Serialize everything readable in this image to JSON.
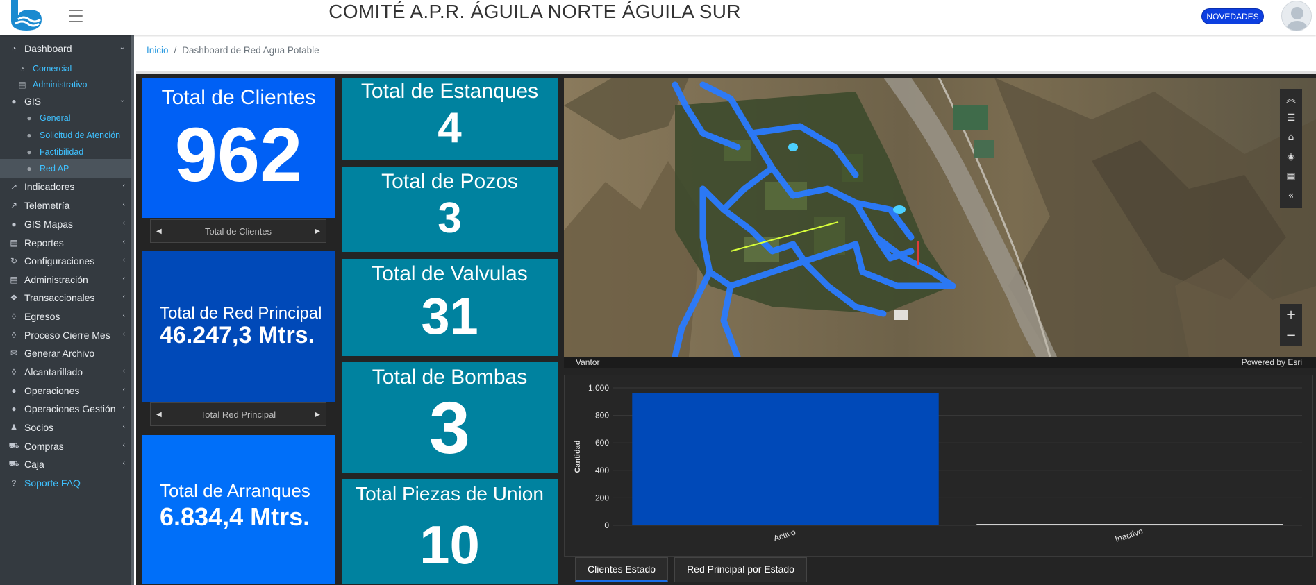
{
  "app": {
    "title": "COMITÉ A.P.R. ÁGUILA NORTE ÁGUILA SUR",
    "news_label": "NOVEDADES"
  },
  "sidebar": {
    "items": [
      {
        "label": "Dashboard",
        "icon": "dashboard-icon",
        "open": true
      },
      {
        "label": "Comercial",
        "icon": "gauge-icon",
        "sub": true
      },
      {
        "label": "Administrativo",
        "icon": "building-icon",
        "sub": true
      },
      {
        "label": "GIS",
        "icon": "globe-icon",
        "open": true
      },
      {
        "label": "General",
        "icon": "globe-icon",
        "sub": true
      },
      {
        "label": "Solicitud de Atención",
        "icon": "globe-icon",
        "sub": true
      },
      {
        "label": "Factibilidad",
        "icon": "globe-icon",
        "sub": true
      },
      {
        "label": "Red AP",
        "icon": "globe-icon",
        "sub": true,
        "active": true
      },
      {
        "label": "Indicadores",
        "icon": "chart-line-icon"
      },
      {
        "label": "Telemetría",
        "icon": "chart-line-icon"
      },
      {
        "label": "GIS Mapas",
        "icon": "globe-icon"
      },
      {
        "label": "Reportes",
        "icon": "list-icon"
      },
      {
        "label": "Configuraciones",
        "icon": "sync-icon"
      },
      {
        "label": "Administración",
        "icon": "building-icon"
      },
      {
        "label": "Transaccionales",
        "icon": "cubes-icon"
      },
      {
        "label": "Egresos",
        "icon": "drop-icon"
      },
      {
        "label": "Proceso Cierre Mes",
        "icon": "drop-icon"
      },
      {
        "label": "Generar Archivo",
        "icon": "envelope-icon"
      },
      {
        "label": "Alcantarillado",
        "icon": "drop-icon"
      },
      {
        "label": "Operaciones",
        "icon": "globe-icon"
      },
      {
        "label": "Operaciones Gestión",
        "icon": "globe-icon"
      },
      {
        "label": "Socios",
        "icon": "users-icon"
      },
      {
        "label": "Compras",
        "icon": "cart-icon"
      },
      {
        "label": "Caja",
        "icon": "cart-icon"
      },
      {
        "label": "Soporte FAQ",
        "icon": "question-icon",
        "link": true
      }
    ]
  },
  "breadcrumb": {
    "home": "Inicio",
    "separator": "/",
    "current": "Dashboard de Red Agua Potable"
  },
  "cards": {
    "clientes": {
      "title": "Total de Clientes",
      "value": "962",
      "pager": "Total de Clientes",
      "color": "#0060f5"
    },
    "red_principal": {
      "title": "Total de Red Principal",
      "value": "46.247,3 Mtrs.",
      "pager": "Total Red Principal",
      "color": "#0049b8"
    },
    "arranques": {
      "title": "Total de Arranques",
      "value": "6.834,4 Mtrs.",
      "color": "#006ff9"
    },
    "estanques": {
      "title": "Total de Estanques",
      "value": "4",
      "color": "#00829f"
    },
    "pozos": {
      "title": "Total de Pozos",
      "value": "3",
      "color": "#00829f"
    },
    "valvulas": {
      "title": "Total de Valvulas",
      "value": "31",
      "color": "#00829f"
    },
    "bombas": {
      "title": "Total de Bombas",
      "value": "3",
      "color": "#00829f"
    },
    "piezas": {
      "title": "Total Piezas de Union",
      "value": "10",
      "color": "#00829f"
    }
  },
  "map": {
    "attribution_left": "Vantor",
    "attribution_right": "Powered by Esri",
    "tools": [
      "collapse-up-icon",
      "legend-list-icon",
      "home-icon",
      "layers-icon",
      "qr-icon",
      "collapse-left-icon"
    ],
    "zoom_in": "+",
    "zoom_out": "−"
  },
  "chart_data": {
    "type": "bar",
    "categories": [
      "Activo",
      "Inactivo"
    ],
    "values": [
      962,
      0
    ],
    "ylabel": "Cantidad",
    "ylim": [
      0,
      1000
    ],
    "yticks": [
      0,
      200,
      400,
      600,
      800,
      1000
    ],
    "ytick_labels": [
      "0",
      "200",
      "400",
      "600",
      "800",
      "1.000"
    ],
    "bar_color": "#0049b8",
    "grid": true
  },
  "tabs": [
    {
      "label": "Clientes Estado",
      "active": true
    },
    {
      "label": "Red Principal por Estado",
      "active": false
    }
  ]
}
